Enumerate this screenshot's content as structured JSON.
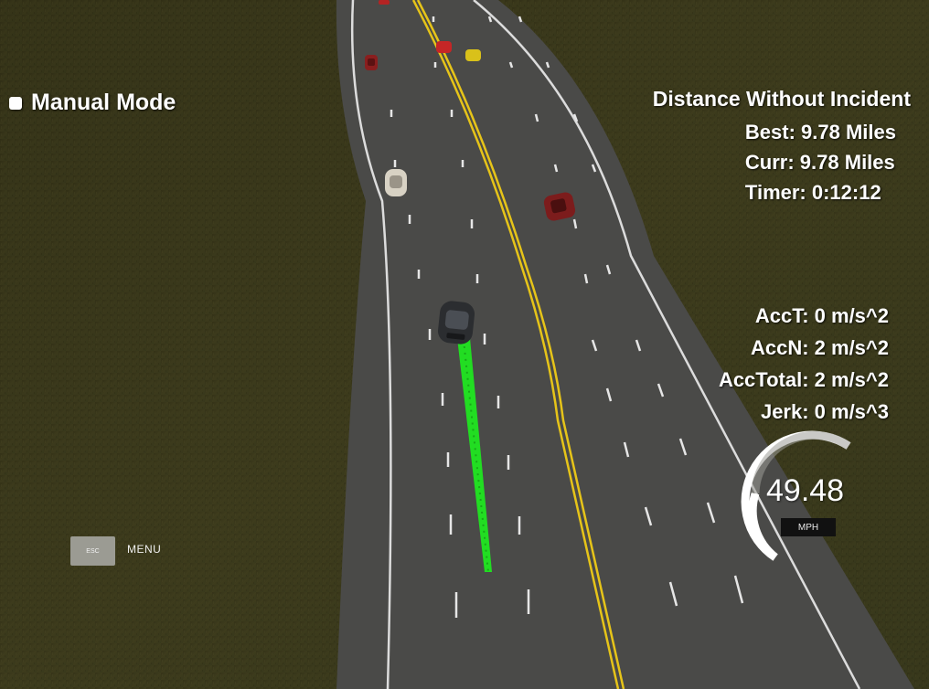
{
  "hud": {
    "mode_label": "Manual Mode",
    "distance_title": "Distance Without Incident",
    "best": "Best: 9.78 Miles",
    "curr": "Curr: 9.78 Miles",
    "timer": "Timer: 0:12:12",
    "acc_t": "AccT: 0 m/s^2",
    "acc_n": "AccN: 2 m/s^2",
    "acc_total": "AccTotal: 2 m/s^2",
    "jerk": "Jerk: 0 m/s^3"
  },
  "controls": {
    "esc_key": "ESC",
    "menu_label": "MENU"
  },
  "speedometer": {
    "speed": "49.48",
    "unit": "MPH"
  },
  "colors": {
    "grass": "#3c3a1c",
    "road": "#4b4b49",
    "center_line": "#e6c419",
    "lane_marks": "#e6e6e6",
    "planned_path": "#22dd22"
  }
}
